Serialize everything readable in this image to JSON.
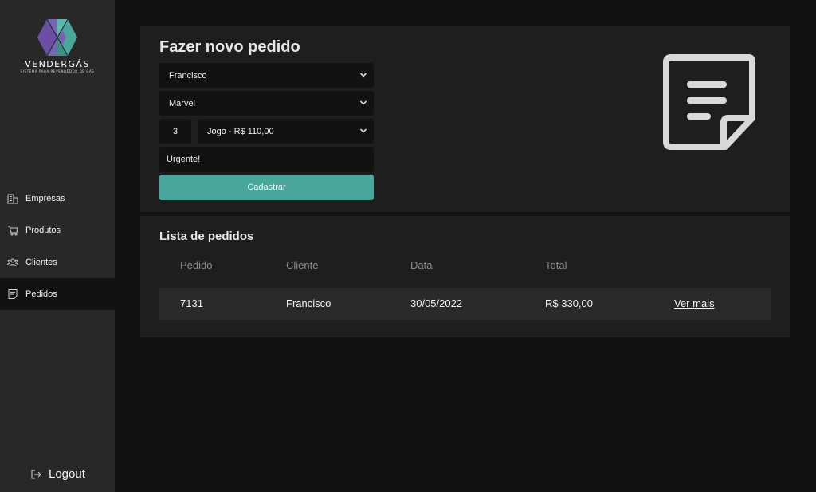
{
  "brand": {
    "name": "VENDERGÁS",
    "tagline": "SISTEMA PARA REVENDEDOR DE GÁS",
    "colors": {
      "purple": "#6b4fa2",
      "teal": "#4aa59a"
    }
  },
  "sidebar": {
    "items": [
      {
        "label": "Empresas",
        "icon": "building-icon",
        "active": false
      },
      {
        "label": "Produtos",
        "icon": "cart-icon",
        "active": false
      },
      {
        "label": "Clientes",
        "icon": "users-icon",
        "active": false
      },
      {
        "label": "Pedidos",
        "icon": "document-icon",
        "active": true
      }
    ],
    "logout_label": "Logout",
    "logout_icon": "logout-icon"
  },
  "form": {
    "title": "Fazer novo pedido",
    "company_select": "Francisco",
    "brand_select": "Marvel",
    "quantity": "3",
    "product_select": "Jogo - R$ 110,00",
    "note": "Urgente!",
    "submit_label": "Cadastrar",
    "illustration_icon": "order-document-icon"
  },
  "orders": {
    "title": "Lista de pedidos",
    "columns": [
      "Pedido",
      "Cliente",
      "Data",
      "Total"
    ],
    "rows": [
      {
        "pedido": "7131",
        "cliente": "Francisco",
        "data": "30/05/2022",
        "total": "R$ 330,00",
        "action": "Ver mais"
      }
    ]
  },
  "theme": {
    "background": "#121212",
    "sidebar": "#282828",
    "card": "#1e1e1e",
    "accent": "#4aa59a"
  }
}
